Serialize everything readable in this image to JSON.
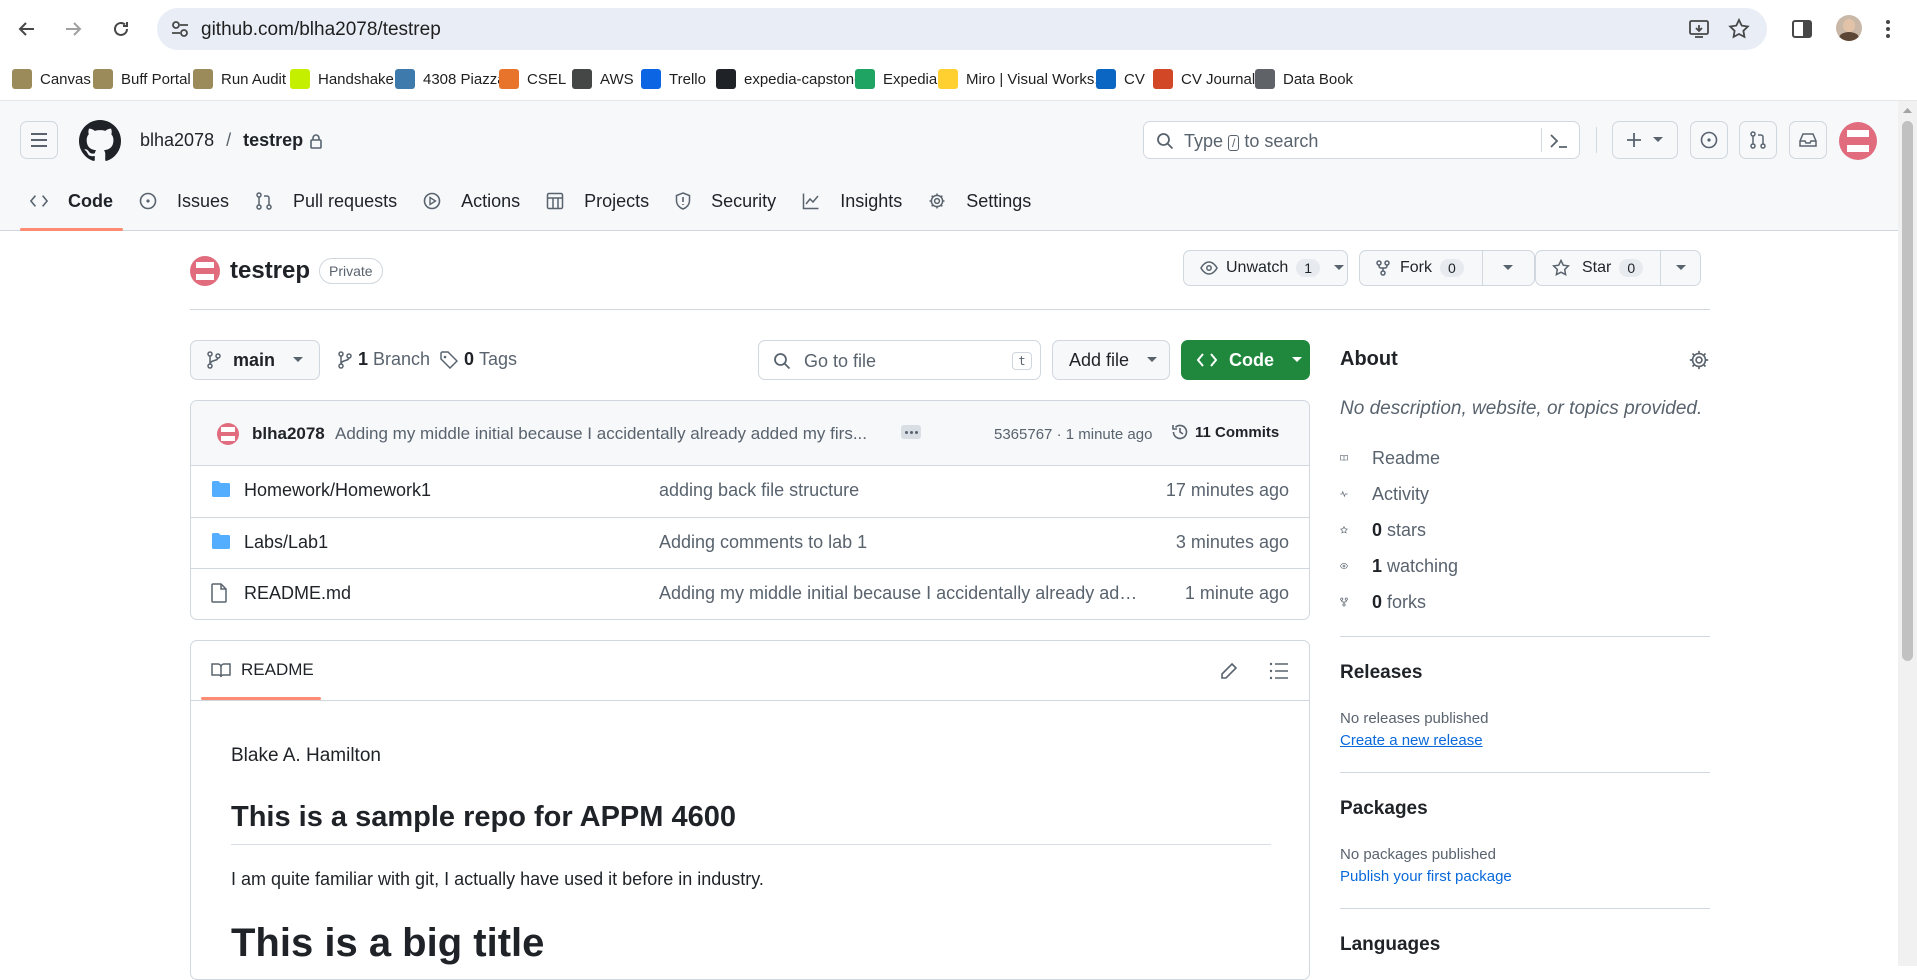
{
  "browser": {
    "url": "github.com/blha2078/testrep",
    "bookmarks": [
      {
        "label": "Canvas",
        "icon": "cu-buffalo-icon",
        "color": "#9b8b5b"
      },
      {
        "label": "Buff Portal",
        "icon": "cu-buffalo-icon",
        "color": "#9b8b5b"
      },
      {
        "label": "Run Audit",
        "icon": "cu-buffalo-icon",
        "color": "#9b8b5b"
      },
      {
        "label": "Handshake",
        "icon": "handshake-icon",
        "color": "#c4f000"
      },
      {
        "label": "4308 Piazza",
        "icon": "piazza-icon",
        "color": "#3e7aab"
      },
      {
        "label": "CSEL",
        "icon": "csel-icon",
        "color": "#e8742b"
      },
      {
        "label": "AWS",
        "icon": "folder-icon",
        "color": "#444746"
      },
      {
        "label": "Trello",
        "icon": "trello-icon",
        "color": "#0c66e4"
      },
      {
        "label": "expedia-capstone",
        "icon": "github-icon",
        "color": "#1f2328"
      },
      {
        "label": "Expedia",
        "icon": "google-drive-icon",
        "color": "#1fa463"
      },
      {
        "label": "Miro | Visual Works...",
        "icon": "miro-icon",
        "color": "#ffd02f"
      },
      {
        "label": "CV",
        "icon": "linkedin-icon",
        "color": "#0a66c2"
      },
      {
        "label": "CV Journal",
        "icon": "powerpoint-icon",
        "color": "#d24726"
      },
      {
        "label": "Data Book",
        "icon": "globe-icon",
        "color": "#5f6368"
      }
    ]
  },
  "header": {
    "owner": "blha2078",
    "separator": "/",
    "repo": "testrep",
    "search_placeholder_pre": "Type",
    "search_key": "/",
    "search_placeholder_post": "to search"
  },
  "tabs": [
    {
      "label": "Code",
      "icon": "code-icon"
    },
    {
      "label": "Issues",
      "icon": "issue-opened-icon"
    },
    {
      "label": "Pull requests",
      "icon": "git-pull-request-icon"
    },
    {
      "label": "Actions",
      "icon": "play-icon"
    },
    {
      "label": "Projects",
      "icon": "table-icon"
    },
    {
      "label": "Security",
      "icon": "shield-icon"
    },
    {
      "label": "Insights",
      "icon": "graph-icon"
    },
    {
      "label": "Settings",
      "icon": "gear-icon"
    }
  ],
  "repo": {
    "name": "testrep",
    "visibility": "Private",
    "watch_label": "Unwatch",
    "watch_count": "1",
    "fork_label": "Fork",
    "fork_count": "0",
    "star_label": "Star",
    "star_count": "0"
  },
  "toolbar": {
    "branch": "main",
    "branch_count": "1",
    "branch_label": "Branch",
    "tag_count": "0",
    "tag_label": "Tags",
    "goto_placeholder": "Go to file",
    "goto_key": "t",
    "add_file": "Add file",
    "code": "Code"
  },
  "commit": {
    "author": "blha2078",
    "message": "Adding my middle initial because I accidentally already added my firs...",
    "sha_time": "5365767 · 1 minute ago",
    "commits_count": "11",
    "commits_label": "Commits"
  },
  "files": [
    {
      "name": "Homework/Homework1",
      "type": "folder",
      "message": "adding back file structure",
      "time": "17 minutes ago"
    },
    {
      "name": "Labs/Lab1",
      "type": "folder",
      "message": "Adding comments to lab 1",
      "time": "3 minutes ago"
    },
    {
      "name": "README.md",
      "type": "file",
      "message": "Adding my middle initial because I accidentally already adde...",
      "time": "1 minute ago"
    }
  ],
  "readme": {
    "tab_label": "README",
    "author_line": "Blake A. Hamilton",
    "h1": "This is a sample repo for APPM 4600",
    "paragraph": "I am quite familiar with git, I actually have used it before in industry.",
    "h1_big": "This is a big title"
  },
  "sidebar": {
    "about_title": "About",
    "about_desc": "No description, website, or topics provided.",
    "items": [
      {
        "bold": "",
        "label": "Readme",
        "icon": "book-icon"
      },
      {
        "bold": "",
        "label": "Activity",
        "icon": "pulse-icon"
      },
      {
        "bold": "0",
        "label": "stars",
        "icon": "star-icon"
      },
      {
        "bold": "1",
        "label": "watching",
        "icon": "eye-icon"
      },
      {
        "bold": "0",
        "label": "forks",
        "icon": "repo-forked-icon"
      }
    ],
    "releases_title": "Releases",
    "releases_text": "No releases published",
    "releases_link": "Create a new release",
    "packages_title": "Packages",
    "packages_text": "No packages published",
    "packages_link": "Publish your first package",
    "languages_title": "Languages"
  },
  "colors": {
    "accent_tab": "#fd8c73",
    "code_button": "#1f883d",
    "link": "#0969da",
    "folder": "#54aeff"
  }
}
